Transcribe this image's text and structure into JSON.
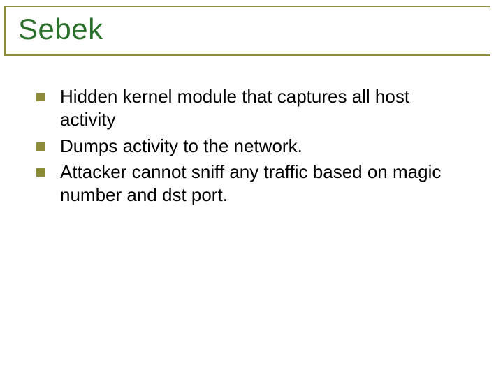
{
  "slide": {
    "title": "Sebek",
    "bullets": [
      {
        "text": "Hidden kernel module that captures all host activity"
      },
      {
        "text": "Dumps activity to the network."
      },
      {
        "text": "Attacker cannot sniff any traffic based on magic number and dst port."
      }
    ]
  },
  "colors": {
    "accent": "#8b8b3a",
    "title": "#2a6f2a"
  }
}
